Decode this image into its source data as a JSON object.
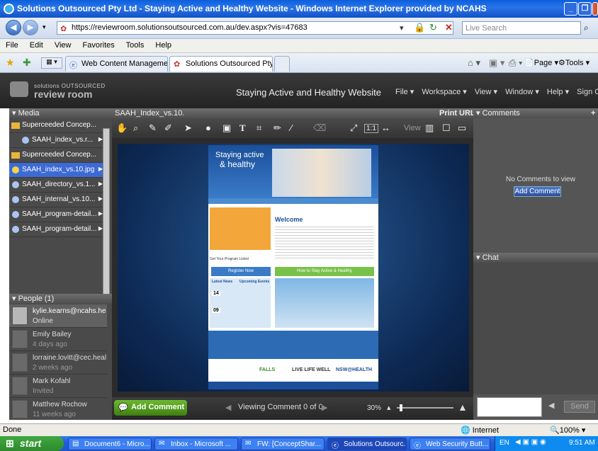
{
  "window": {
    "title": "Solutions Outsourced Pty Ltd - Staying Active and Healthy Website - Windows Internet Explorer provided by NCAHS"
  },
  "browser": {
    "url": "https://reviewroom.solutionsoutsourced.com.au/dev.aspx?vis=47683",
    "search_placeholder": "Live Search",
    "menu": [
      "File",
      "Edit",
      "View",
      "Favorites",
      "Tools",
      "Help"
    ],
    "tabs": [
      {
        "label": "Web Content Management, ..."
      },
      {
        "label": "Solutions Outsourced Pty... X"
      }
    ],
    "toolbar": {
      "page": "Page ▾",
      "tools": "Tools ▾"
    }
  },
  "app": {
    "brand_small": "solutions OUTSOURCED",
    "brand_large": "review room",
    "title": "Staying Active and Healthy Website",
    "menu": [
      "File ▾",
      "Workspace ▾",
      "View ▾",
      "Window ▾",
      "Help ▾",
      "Sign Out"
    ]
  },
  "media": {
    "header": "▾ Media",
    "items": [
      {
        "label": "Superceeded Concep...",
        "type": "folder",
        "arrow": "▶"
      },
      {
        "label": "SAAH_index_vs.r...",
        "type": "file",
        "arrow": "▶"
      },
      {
        "label": "Superceeded Concep...",
        "type": "folder",
        "arrow": ""
      },
      {
        "label": "SAAH_index_vs.10.jpg",
        "type": "file",
        "arrow": "▶",
        "selected": true
      },
      {
        "label": "SAAH_directory_vs.1...",
        "type": "file",
        "arrow": "▶"
      },
      {
        "label": "SAAH_internal_vs.10...",
        "type": "file",
        "arrow": "▶"
      },
      {
        "label": "SAAH_program-detail...",
        "type": "file",
        "arrow": "▶"
      },
      {
        "label": "SAAH_program-detail...",
        "type": "file",
        "arrow": "▶"
      }
    ]
  },
  "people": {
    "header": "▾ People (1)",
    "items": [
      {
        "name": "kylie.kearns@ncahs.he",
        "status": "Online"
      },
      {
        "name": "Emily Bailey",
        "status": "4 days ago"
      },
      {
        "name": "lorraine.lovitt@cec.healt",
        "status": "2 weeks ago"
      },
      {
        "name": "Mark Kofahl",
        "status": "Invited"
      },
      {
        "name": "Matthew Rochow",
        "status": "11 weeks ago"
      }
    ]
  },
  "viewer": {
    "file": "SAAH_Index_vs.10.",
    "print": "Print",
    "url": "URL",
    "view_label": "View",
    "zoom_1to1": "1:1",
    "add_comment": "Add Comment",
    "viewing": "Viewing Comment 0 of 0",
    "zoom": "30%"
  },
  "site": {
    "hero_line1": "Staying active",
    "hero_line2": "& healthy",
    "welcome": "Welcome",
    "register": "Register Now",
    "program": "Get Your Program Listed",
    "how_to": "How to Stay Active & Healthy",
    "latest_news": "Latest News",
    "upcoming_events": "Upcoming Events",
    "news_dates": [
      "14",
      "09"
    ],
    "logos": [
      "FALLS",
      "LIVE LIFE WELL",
      "NSW@HEALTH"
    ]
  },
  "comments": {
    "header": "▾ Comments",
    "plus": "+",
    "empty": "No Comments to view",
    "add": "Add Comment"
  },
  "chat": {
    "header": "▾ Chat",
    "send": "Send"
  },
  "status": {
    "left": "Done",
    "zone": "Internet",
    "zoom": "100%"
  },
  "taskbar": {
    "start": "start",
    "tasks": [
      "Document6 - Micro...",
      "Inbox - Microsoft ...",
      "FW: [ConceptShar...",
      "Solutions Outsourc...",
      "Web Security Butt..."
    ],
    "lang": "EN",
    "time": "9:51 AM"
  }
}
